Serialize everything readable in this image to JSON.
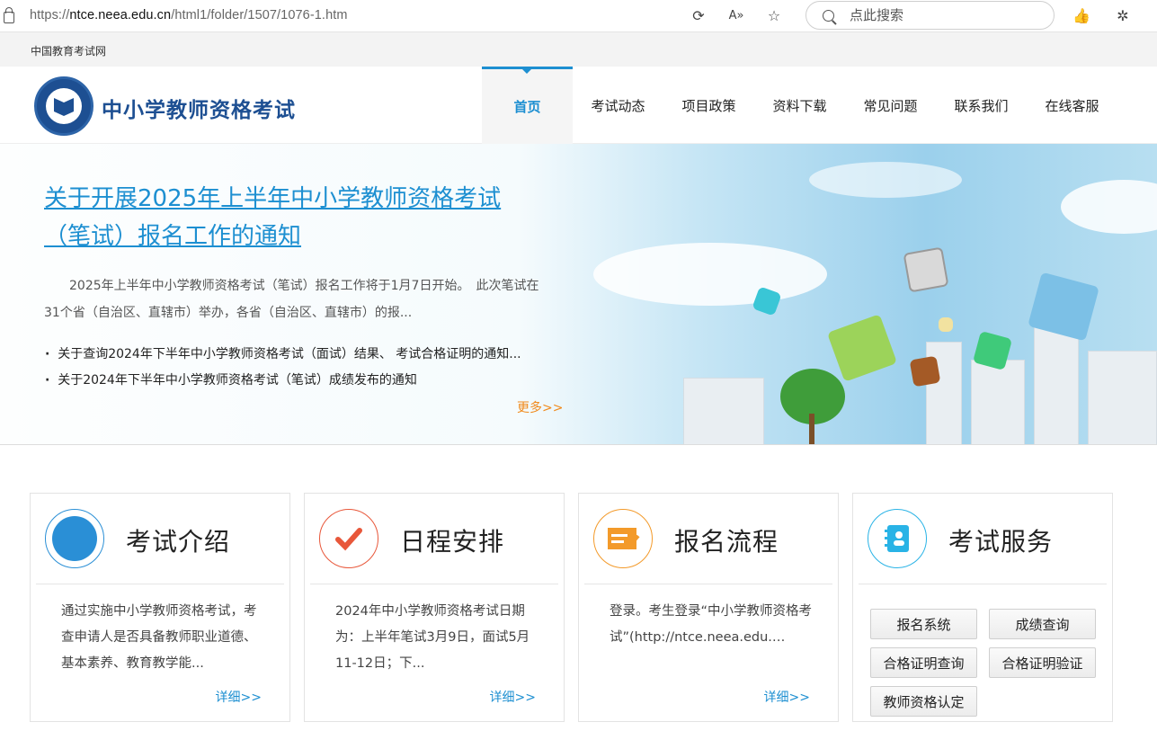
{
  "browser": {
    "url_prefix": "https://",
    "url_domain": "ntce.neea.edu.cn",
    "url_path": "/html1/folder/1507/1076-1.htm",
    "search_placeholder": "点此搜索"
  },
  "site": {
    "top_link": "中国教育考试网",
    "logo_text": "中小学教师资格考试"
  },
  "nav": [
    {
      "label": "首页",
      "active": true
    },
    {
      "label": "考试动态"
    },
    {
      "label": "项目政策"
    },
    {
      "label": "资料下载"
    },
    {
      "label": "常见问题"
    },
    {
      "label": "联系我们"
    },
    {
      "label": "在线客服"
    }
  ],
  "banner": {
    "headline": "关于开展2025年上半年中小学教师资格考试（笔试）报名工作的通知",
    "summary": "2025年上半年中小学教师资格考试（笔试）报名工作将于1月7日开始。　此次笔试在31个省（自治区、直辖市）举办，各省（自治区、直辖市）的报...",
    "news": [
      "关于查询2024年下半年中小学教师资格考试（面试）结果、 考试合格证明的通知...",
      "关于2024年下半年中小学教师资格考试（笔试）成绩发布的通知"
    ],
    "more": "更多>>"
  },
  "cards": [
    {
      "title": "考试介绍",
      "icon": "document-pen-icon",
      "color": "#2a8fd6",
      "text": "通过实施中小学教师资格考试，考查申请人是否具备教师职业道德、基本素养、教育教学能...",
      "more": "详细>>"
    },
    {
      "title": "日程安排",
      "icon": "checkmark-icon",
      "color": "#e8573a",
      "text": "2024年中小学教师资格考试日期为：上半年笔试3月9日，面试5月11-12日；下...",
      "more": "详细>>"
    },
    {
      "title": "报名流程",
      "icon": "form-edit-icon",
      "color": "#f39a2a",
      "text": "登录。考生登录“中小学教师资格考试”(http://ntce.neea.edu.…",
      "more": "详细>>"
    },
    {
      "title": "考试服务",
      "icon": "contact-book-icon",
      "color": "#29b3e6"
    }
  ],
  "services": [
    "报名系统",
    "成绩查询",
    "合格证明查询",
    "合格证明验证",
    "教师资格认定"
  ]
}
